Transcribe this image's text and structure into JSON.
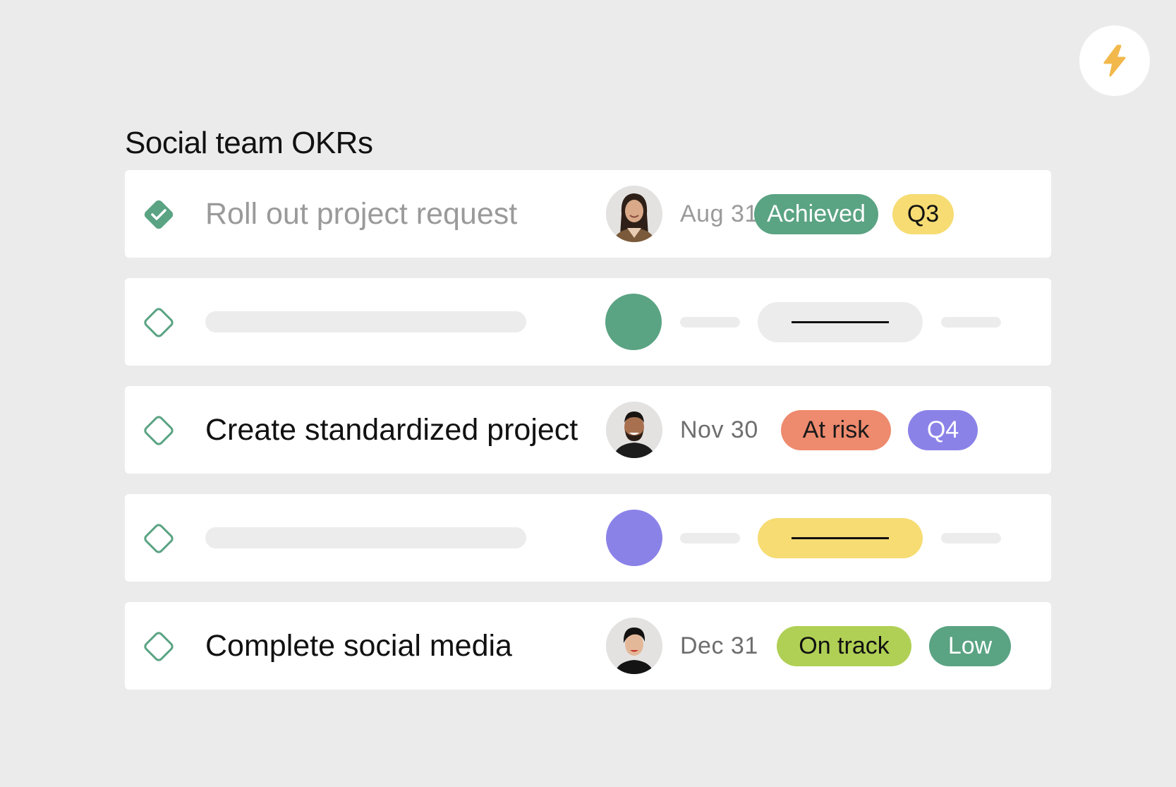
{
  "header": {
    "title": "Social team OKRs",
    "action_icon": "lightning-bolt-icon"
  },
  "colors": {
    "green": "#5aa383",
    "yellow": "#f6dc72",
    "coral": "#ee8a6e",
    "purple": "#8b82e8",
    "lime": "#b0d055",
    "skeleton": "#edecec",
    "bolt": "#f2b84b"
  },
  "okrs": [
    {
      "title": "Roll out project request",
      "completed": true,
      "owner_avatar": "avatar-woman-long-hair",
      "due_date": "Aug 31",
      "status": {
        "label": "Achieved",
        "color": "#5aa383",
        "text_color": "#ffffff"
      },
      "period": {
        "label": "Q3",
        "color": "#f6dc72",
        "text_color": "#111111"
      }
    },
    {
      "title": "",
      "completed": false,
      "placeholder": true,
      "owner_avatar_color": "#5aa383",
      "status_color": "#edecec"
    },
    {
      "title": "Create standardized project",
      "completed": false,
      "owner_avatar": "avatar-man-beard",
      "due_date": "Nov 30",
      "status": {
        "label": "At risk",
        "color": "#ee8a6e",
        "text_color": "#1a1a1a"
      },
      "period": {
        "label": "Q4",
        "color": "#8b82e8",
        "text_color": "#ffffff"
      }
    },
    {
      "title": "",
      "completed": false,
      "placeholder": true,
      "owner_avatar_color": "#8b82e8",
      "status_color": "#f6dc72"
    },
    {
      "title": "Complete social media",
      "completed": false,
      "owner_avatar": "avatar-woman-short-hair",
      "due_date": "Dec 31",
      "status": {
        "label": "On track",
        "color": "#b0d055",
        "text_color": "#111111"
      },
      "period": {
        "label": "Low",
        "color": "#5aa383",
        "text_color": "#ffffff"
      }
    }
  ]
}
